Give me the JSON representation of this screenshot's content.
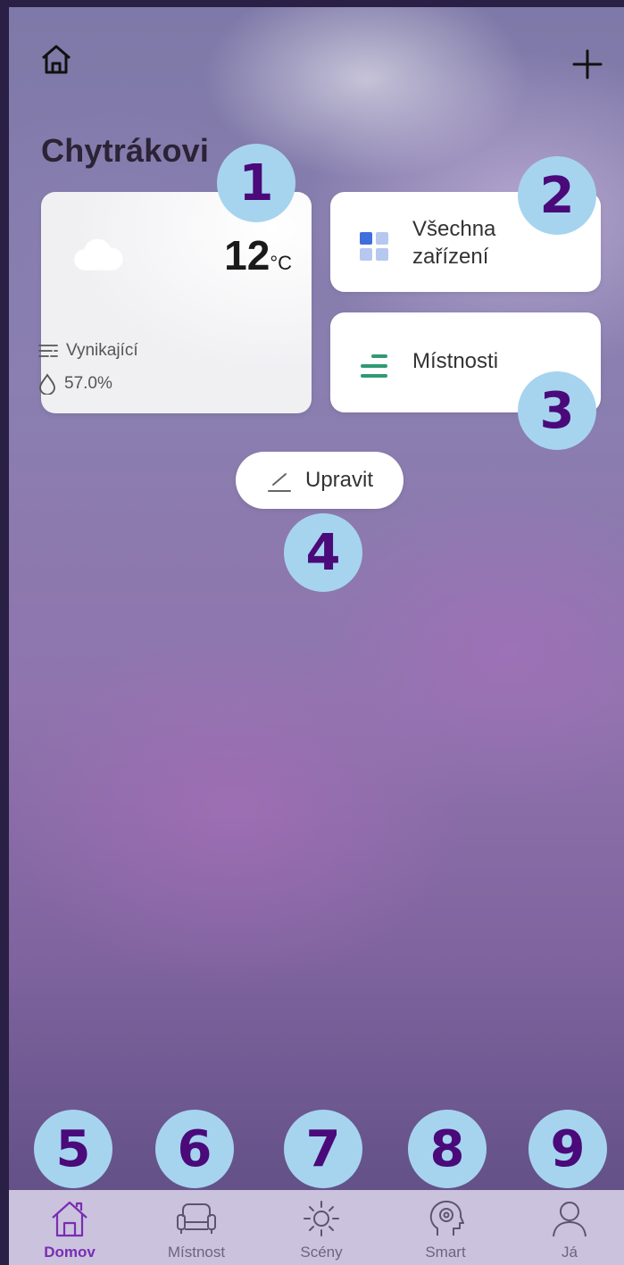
{
  "header": {
    "home_icon": "home-icon",
    "add_icon": "plus-icon"
  },
  "home_title": "Chytrákovi",
  "weather": {
    "temperature": "12",
    "unit": "°C",
    "air_quality": "Vynikající",
    "humidity": "57.0%",
    "icons": [
      "cloud-icon",
      "air-quality-icon",
      "humidity-drop-icon"
    ]
  },
  "tiles": {
    "devices": {
      "line1": "Všechna",
      "line2": "zařízení",
      "icon": "grid-icon"
    },
    "rooms": {
      "label": "Místnosti",
      "icon": "list-lines-icon"
    }
  },
  "edit_button": {
    "label": "Upravit",
    "icon": "pencil-icon"
  },
  "badges": [
    "1",
    "2",
    "3",
    "4",
    "5",
    "6",
    "7",
    "8",
    "9"
  ],
  "tabs": [
    {
      "label": "Domov",
      "icon": "home-icon",
      "active": true
    },
    {
      "label": "Místnost",
      "icon": "armchair-icon",
      "active": false
    },
    {
      "label": "Scény",
      "icon": "sun-icon",
      "active": false
    },
    {
      "label": "Smart",
      "icon": "brain-head-icon",
      "active": false
    },
    {
      "label": "Já",
      "icon": "user-icon",
      "active": false
    }
  ],
  "colors": {
    "accent": "#7a2db3",
    "badge_bg": "#a6d4ef",
    "badge_text": "#4a0a7a",
    "tabbar_bg": "#cbc3dd"
  }
}
